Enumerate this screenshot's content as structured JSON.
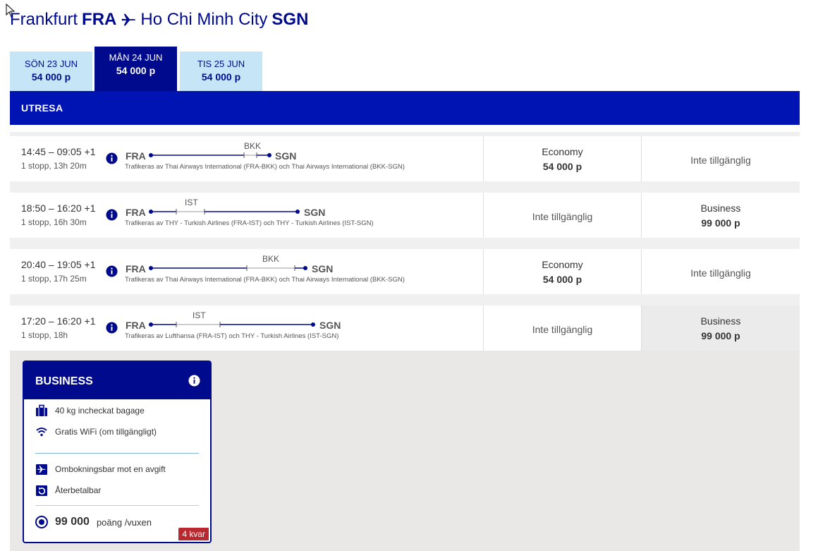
{
  "route": {
    "from_city": "Frankfurt",
    "from_code": "FRA",
    "to_city": "Ho Chi Minh City",
    "to_code": "SGN"
  },
  "date_tabs": [
    {
      "date": "SÖN 23 JUN",
      "price": "54 000 p"
    },
    {
      "date": "MÅN 24 JUN",
      "price": "54 000 p"
    },
    {
      "date": "TIS 25 JUN",
      "price": "54 000 p"
    }
  ],
  "section_label": "UTRESA",
  "flights": [
    {
      "times": "14:45 – 09:05 +1",
      "stops": "1 stopp, 13h 20m",
      "from": "FRA",
      "via": "BKK",
      "to": "SGN",
      "operated": "Trafikeras av Thai Airways International (FRA-BKK) och Thai Airways International (BKK-SGN)",
      "col1": {
        "class": "Economy",
        "price": "54 000 p",
        "available": true
      },
      "col2": {
        "text": "Inte tillgänglig",
        "available": false
      }
    },
    {
      "times": "18:50 – 16:20 +1",
      "stops": "1 stopp, 16h 30m",
      "from": "FRA",
      "via": "IST",
      "to": "SGN",
      "operated": "Trafikeras av THY - Turkish Airlines (FRA-IST) och THY - Turkish Airlines (IST-SGN)",
      "col1": {
        "text": "Inte tillgänglig",
        "available": false
      },
      "col2": {
        "class": "Business",
        "price": "99 000 p",
        "available": true
      }
    },
    {
      "times": "20:40 – 19:05 +1",
      "stops": "1 stopp, 17h 25m",
      "from": "FRA",
      "via": "BKK",
      "to": "SGN",
      "operated": "Trafikeras av Thai Airways International (FRA-BKK) och Thai Airways International (BKK-SGN)",
      "col1": {
        "class": "Economy",
        "price": "54 000 p",
        "available": true
      },
      "col2": {
        "text": "Inte tillgänglig",
        "available": false
      }
    },
    {
      "times": "17:20 – 16:20 +1",
      "stops": "1 stopp, 18h",
      "from": "FRA",
      "via": "IST",
      "to": "SGN",
      "operated": "Trafikeras av Lufthansa (FRA-IST) och THY - Turkish Airlines (IST-SGN)",
      "col1": {
        "text": "Inte tillgänglig",
        "available": false
      },
      "col2": {
        "class": "Business",
        "price": "99 000 p",
        "available": true
      }
    }
  ],
  "business_card": {
    "title": "BUSINESS",
    "features": [
      "40 kg incheckat bagage",
      "Gratis WiFi (om tillgängligt)"
    ],
    "conditions": [
      "Ombokningsbar mot en avgift",
      "Återbetalbar"
    ],
    "points": "99 000",
    "points_unit": "poäng /vuxen",
    "remaining": "4 kvar"
  },
  "colors": {
    "brand_navy": "#000a8c",
    "brand_blue": "#0014b4",
    "tab_light": "#c6e6f8",
    "badge_red": "#b8282e"
  }
}
